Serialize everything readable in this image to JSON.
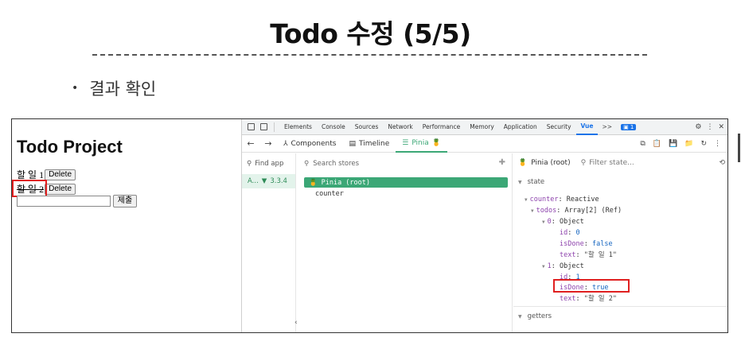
{
  "slide": {
    "title": "Todo 수정 (5/5)",
    "bullet": "결과 확인"
  },
  "app": {
    "title": "Todo Project",
    "todos": [
      {
        "text": "할 일 1",
        "delete_label": "Delete"
      },
      {
        "text": "할 일 2",
        "delete_label": "Delete"
      }
    ],
    "input_value": "",
    "submit_label": "제출"
  },
  "devtools": {
    "tabs": [
      "Elements",
      "Console",
      "Sources",
      "Network",
      "Performance",
      "Memory",
      "Application",
      "Security",
      "Vue"
    ],
    "active_tab": "Vue",
    "overflow_label": ">>",
    "badge": "1",
    "vue_tabs": [
      {
        "label": "Components",
        "icon": "components-icon"
      },
      {
        "label": "Timeline",
        "icon": "timeline-icon"
      },
      {
        "label": "Pinia",
        "icon": "pinia-icon"
      }
    ],
    "active_vue_tab": "Pinia",
    "find_app_placeholder": "Find app",
    "app_entry": {
      "name": "A...",
      "version": "3.3.4"
    },
    "search_stores_placeholder": "Search stores",
    "stores": [
      "Pinia (root)",
      "counter"
    ],
    "inspector": {
      "title": "Pinia (root)",
      "filter_placeholder": "Filter state...",
      "state_label": "state",
      "getters_label": "getters",
      "tree": {
        "counter_key": "counter",
        "counter_val": "Reactive",
        "todos_key": "todos",
        "todos_val": "Array[2] (Ref)",
        "item0_key": "0",
        "item0_val": "Object",
        "item0_id_key": "id",
        "item0_id_val": "0",
        "item0_done_key": "isDone",
        "item0_done_val": "false",
        "item0_text_key": "text",
        "item0_text_val": "\"할 일 1\"",
        "item1_key": "1",
        "item1_val": "Object",
        "item1_id_key": "id",
        "item1_id_val": "1",
        "item1_done_key": "isDone",
        "item1_done_val": "true",
        "item1_text_key": "text",
        "item1_text_val": "\"할 일 2\""
      }
    }
  }
}
